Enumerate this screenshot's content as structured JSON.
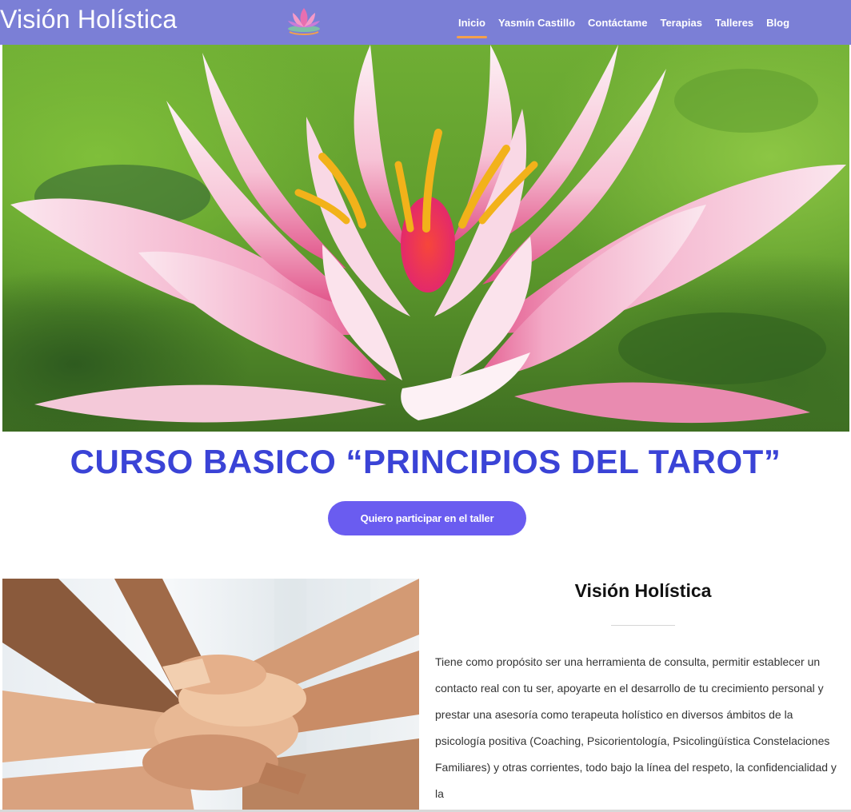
{
  "header": {
    "brand": "Visión Holística",
    "logo_icon": "lotus-logo-icon",
    "nav": [
      {
        "label": "Inicio",
        "active": true
      },
      {
        "label": "Yasmín Castillo",
        "active": false
      },
      {
        "label": "Contáctame",
        "active": false
      },
      {
        "label": "Terapias",
        "active": false
      },
      {
        "label": "Talleres",
        "active": false
      },
      {
        "label": "Blog",
        "active": false
      }
    ]
  },
  "hero": {
    "image": "pink-lotus-flower-image"
  },
  "course": {
    "title": "CURSO BASICO “PRINCIPIOS DEL TAROT”",
    "cta_label": "Quiero participar en el taller"
  },
  "about": {
    "image": "stacked-hands-image",
    "title": "Visión Holística",
    "text": "Tiene como propósito ser una herramienta de consulta, permitir establecer un contacto real con tu ser, apoyarte en el desarrollo de tu crecimiento personal  y prestar una asesoría como terapeuta holístico en diversos ámbitos de la psicología positiva (Coaching, Psicorientología, Psicolingüística  Constelaciones Familiares) y otras corrientes, todo bajo la línea del respeto, la confidencialidad y la"
  },
  "colors": {
    "header_bg": "#7b7fd6",
    "title": "#3a43d6",
    "cta_bg": "#6a5cf0",
    "active_underline": "#f5a04a"
  }
}
